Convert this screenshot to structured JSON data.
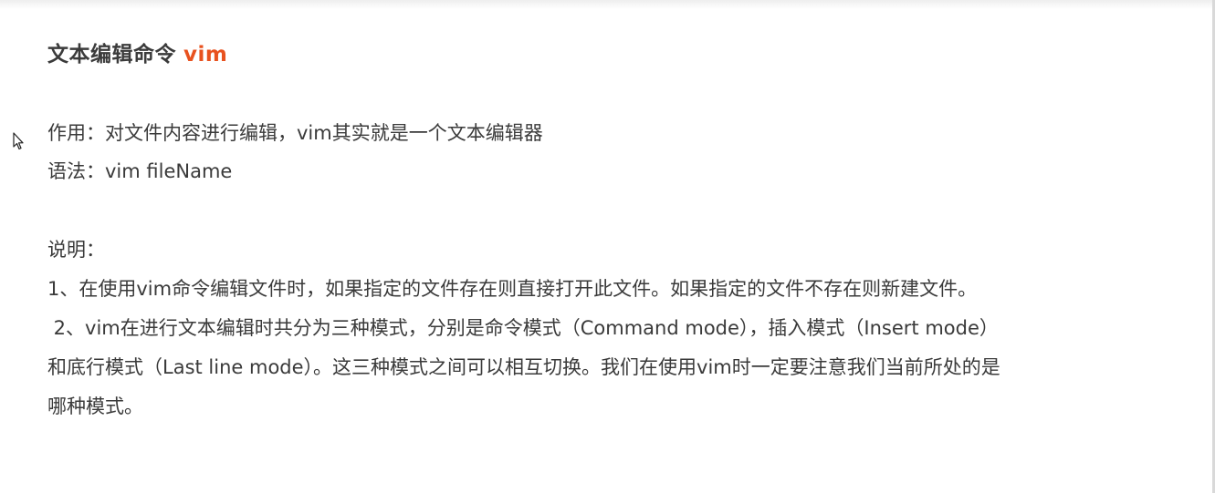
{
  "heading": {
    "title": "文本编辑命令",
    "keyword": "vim"
  },
  "content": {
    "purpose": "作用：对文件内容进行编辑，vim其实就是一个文本编辑器",
    "syntax": "语法：vim fileName",
    "note_label": "说明：",
    "note_1": "1、在使用vim命令编辑文件时，如果指定的文件存在则直接打开此文件。如果指定的文件不存在则新建文件。",
    "note_2_line1": " 2、vim在进行文本编辑时共分为三种模式，分别是命令模式（Command mode），插入模式（Insert mode）",
    "note_2_line2": "和底行模式（Last line mode）。这三种模式之间可以相互切换。我们在使用vim时一定要注意我们当前所处的是",
    "note_2_line3": "哪种模式。"
  },
  "colors": {
    "accent": "#e8521f",
    "text": "#3a3a3a"
  },
  "icons": {
    "cursor": "mouse-pointer-icon"
  }
}
